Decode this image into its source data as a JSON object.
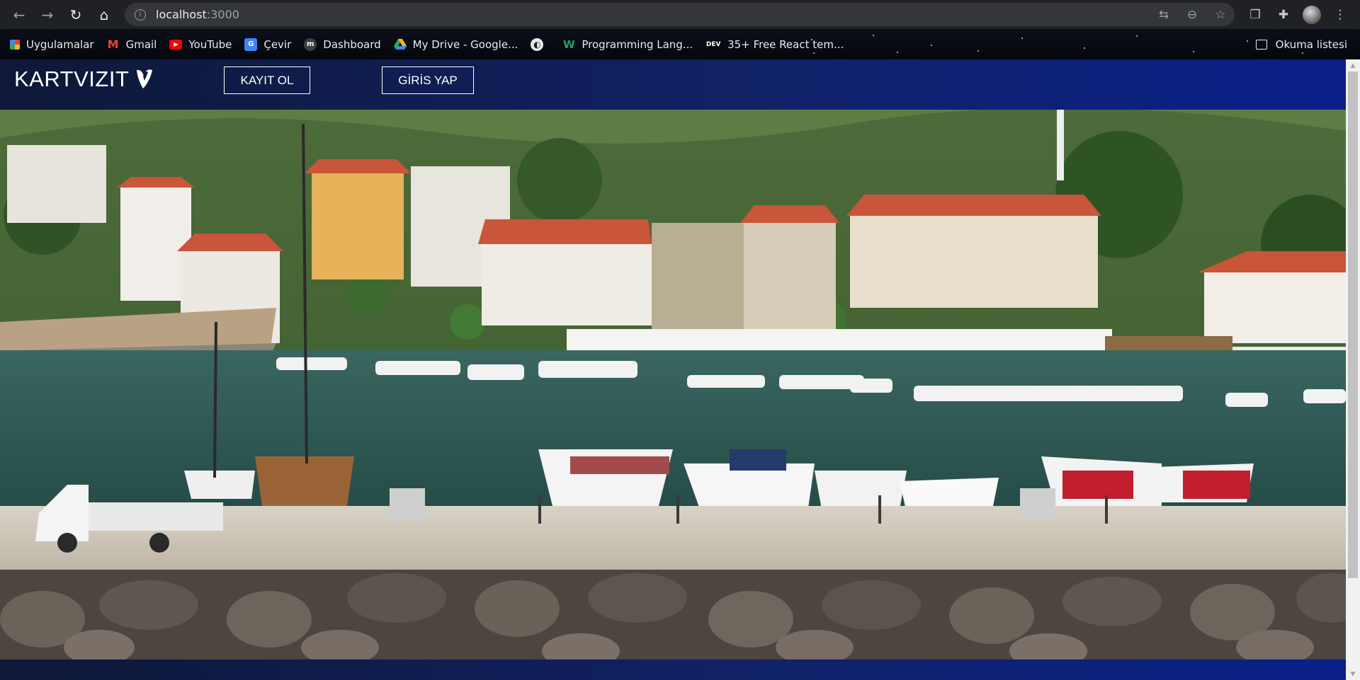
{
  "browser": {
    "url_host": "localhost",
    "url_port": ":3000",
    "bookmarks": [
      {
        "label": "Uygulamalar",
        "icon": "apps-grid-icon"
      },
      {
        "label": "Gmail",
        "icon": "gmail-icon"
      },
      {
        "label": "YouTube",
        "icon": "youtube-icon"
      },
      {
        "label": "Çevir",
        "icon": "google-translate-icon"
      },
      {
        "label": "Dashboard",
        "icon": "dashboard-icon"
      },
      {
        "label": "My Drive - Google...",
        "icon": "google-drive-icon"
      },
      {
        "label": "",
        "icon": "globe-icon"
      },
      {
        "label": "Programming Lang...",
        "icon": "w-icon"
      },
      {
        "label": "35+ Free React tem...",
        "icon": "dev-icon",
        "icon_text": "DEV"
      }
    ],
    "reading_list_label": "Okuma listesi"
  },
  "site": {
    "brand": "KARTVIZIT",
    "register_label": "KAYIT OL",
    "login_label": "GİRİS YAP",
    "header_gradient": [
      "#0f1837",
      "#0a1f8a"
    ]
  },
  "hero": {
    "alt_subject": "harbor-photo",
    "water_color": "#2f5a56",
    "roof_color": "#c9553a"
  }
}
